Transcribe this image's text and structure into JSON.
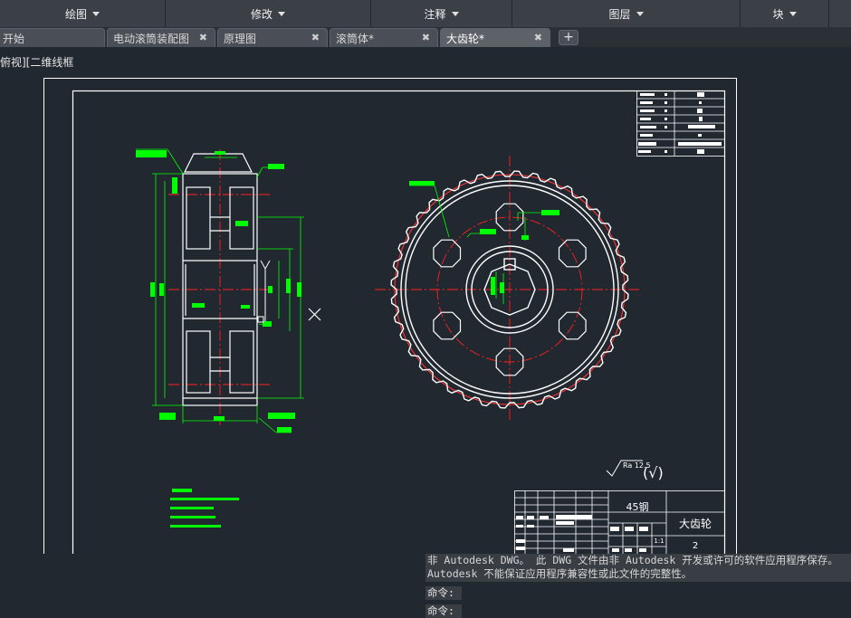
{
  "ribbon": {
    "panels": [
      {
        "label": "绘图"
      },
      {
        "label": "修改"
      },
      {
        "label": "注释"
      },
      {
        "label": "图层"
      },
      {
        "label": "块"
      }
    ]
  },
  "tabs": [
    {
      "label": "开始"
    },
    {
      "label": "电动滚筒装配图"
    },
    {
      "label": "原理图"
    },
    {
      "label": "滚筒体*"
    },
    {
      "label": "大齿轮*",
      "active": true
    }
  ],
  "view_label": "俯视][二维线框",
  "drawing": {
    "material": "45钢",
    "part_name": "大齿轮",
    "sheet_number": "2",
    "scale": "1:1",
    "roughness_symbol": "Ra 12.5",
    "roughness_note": "(√)",
    "colors": {
      "background": "#212830",
      "frame": "#ffffff",
      "dimension": "#00ff00",
      "centerline": "#ff2020"
    }
  },
  "command": {
    "message_line1": "非 Autodesk DWG。  此 DWG 文件由非 Autodesk 开发或许可的软件应用程序保存。",
    "message_line2": "Autodesk 不能保证应用程序兼容性或此文件的完整性。",
    "prompt1": "命令:",
    "prompt2": "命令:"
  }
}
